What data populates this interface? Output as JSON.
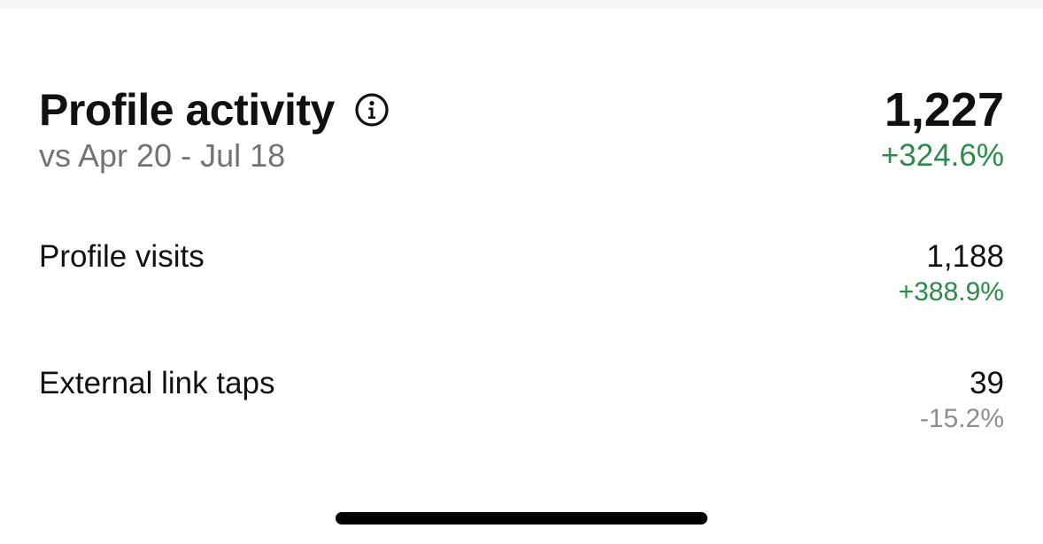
{
  "header": {
    "title": "Profile activity",
    "info_icon": "info-circle-icon",
    "subtitle": "vs Apr 20 - Jul 18",
    "total_value": "1,227",
    "total_change": "+324.6%"
  },
  "metrics": [
    {
      "label": "Profile visits",
      "value": "1,188",
      "change": "+388.9%",
      "trend": "positive"
    },
    {
      "label": "External link taps",
      "value": "39",
      "change": "-15.2%",
      "trend": "negative"
    }
  ],
  "colors": {
    "positive": "#2d8a4b",
    "negative": "#8e8e8e",
    "text": "#111111",
    "muted": "#737373"
  }
}
